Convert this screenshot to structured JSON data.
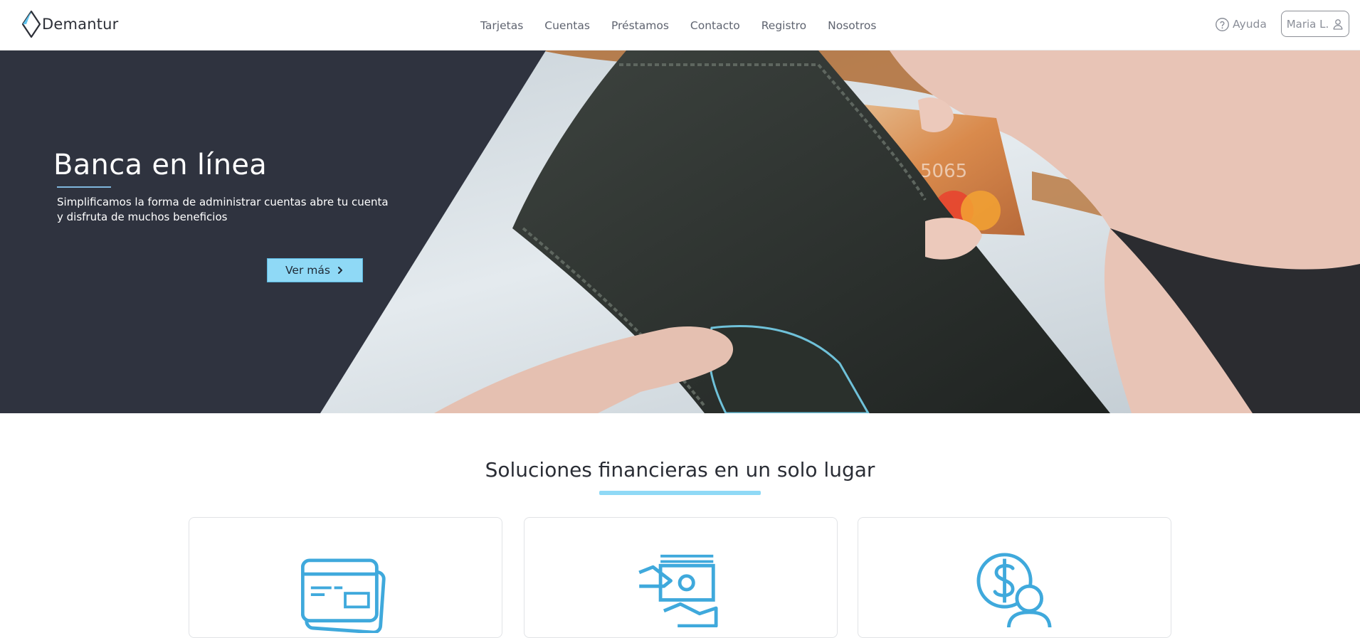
{
  "brand": {
    "name": "Demantur",
    "logo_icon": "diamond-logo-icon"
  },
  "nav": {
    "items": [
      {
        "label": "Tarjetas"
      },
      {
        "label": "Cuentas"
      },
      {
        "label": "Préstamos"
      },
      {
        "label": "Contacto"
      },
      {
        "label": "Registro"
      },
      {
        "label": "Nosotros"
      }
    ],
    "help_label": "Ayuda",
    "help_icon": "question-circle-icon",
    "user_label": "Maria L.",
    "user_icon": "user-icon"
  },
  "hero": {
    "title": "Banca en línea",
    "description": "Simplificamos la forma de administrar cuentas abre tu cuenta y disfruta de muchos beneficios",
    "cta_label": "Ver más",
    "cta_icon": "chevron-right-icon",
    "image": "wallet-credit-card-photo"
  },
  "solutions": {
    "title": "Soluciones financieras en un solo lugar",
    "cards": [
      {
        "icon": "credit-cards-icon"
      },
      {
        "icon": "cash-hand-icon"
      },
      {
        "icon": "dollar-user-icon"
      }
    ]
  },
  "colors": {
    "accent": "#8fd9f6",
    "icon_blue": "#3fa9dc",
    "hero_dark": "#2f333f",
    "text_dark": "#2b2f3a",
    "nav_text": "#5f6470"
  }
}
